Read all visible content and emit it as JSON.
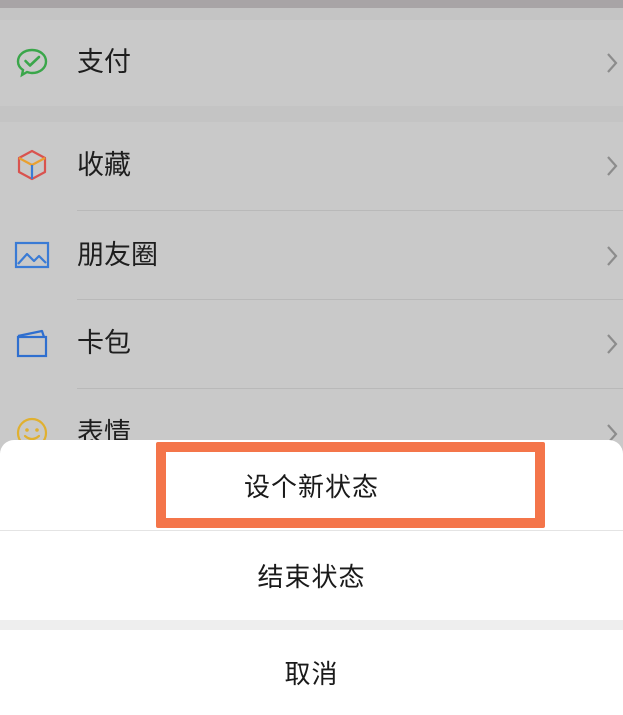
{
  "menu": {
    "pay_group": [
      {
        "label": "支付",
        "icon": "wechat-pay-icon"
      }
    ],
    "main_group": [
      {
        "label": "收藏",
        "icon": "favorites-cube-icon"
      },
      {
        "label": "朋友圈",
        "icon": "moments-picture-icon"
      },
      {
        "label": "卡包",
        "icon": "card-wallet-icon"
      },
      {
        "label": "表情",
        "icon": "sticker-smiley-icon"
      }
    ]
  },
  "action_sheet": {
    "set_new_status": "设个新状态",
    "end_status": "结束状态",
    "cancel": "取消"
  },
  "colors": {
    "highlight_border": "#f4754a",
    "pay_icon": "#3aa64a",
    "moments_icon": "#3a7bd5",
    "card_icon": "#2f6fcf",
    "sticker_icon": "#e0b030"
  }
}
